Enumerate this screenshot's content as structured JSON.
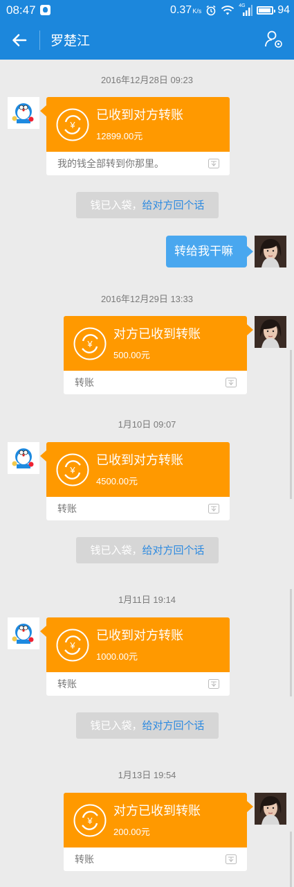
{
  "status_bar": {
    "time": "08:47",
    "network_speed": "0.37",
    "network_speed_unit": "K/s",
    "network_type": "4G",
    "battery": "94"
  },
  "header": {
    "title": "罗楚江",
    "accent_color": "#1c87dc"
  },
  "messages": [
    {
      "type": "timestamp",
      "text": "2016年12月28日 09:23"
    },
    {
      "type": "transfer",
      "side": "left",
      "title": "已收到对方转账",
      "amount": "12899.00元",
      "note": "我的钱全部转到你那里。"
    },
    {
      "type": "system",
      "text": "钱已入袋，",
      "link": "给对方回个话"
    },
    {
      "type": "text",
      "side": "right",
      "text": "转给我干嘛"
    },
    {
      "type": "timestamp",
      "text": "2016年12月29日 13:33"
    },
    {
      "type": "transfer",
      "side": "right",
      "title": "对方已收到转账",
      "amount": "500.00元",
      "note": "转账"
    },
    {
      "type": "timestamp",
      "text": "1月10日 09:07"
    },
    {
      "type": "transfer",
      "side": "left",
      "title": "已收到对方转账",
      "amount": "4500.00元",
      "note": "转账"
    },
    {
      "type": "system",
      "text": "钱已入袋，",
      "link": "给对方回个话"
    },
    {
      "type": "timestamp",
      "text": "1月11日 19:14"
    },
    {
      "type": "transfer",
      "side": "left",
      "title": "已收到对方转账",
      "amount": "1000.00元",
      "note": "转账"
    },
    {
      "type": "system",
      "text": "钱已入袋，",
      "link": "给对方回个话"
    },
    {
      "type": "timestamp",
      "text": "1月13日 19:54"
    },
    {
      "type": "transfer",
      "side": "right",
      "title": "对方已收到转账",
      "amount": "200.00元",
      "note": "转账"
    }
  ],
  "colors": {
    "transfer_orange": "#ff9900",
    "bubble_blue": "#49a7ef",
    "link_blue": "#2d8ae0",
    "background": "#ebebeb"
  }
}
